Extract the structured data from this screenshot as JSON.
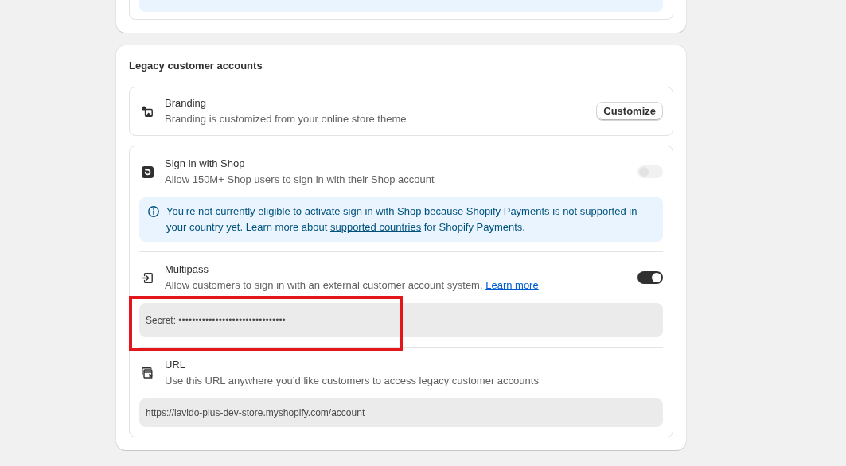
{
  "section": {
    "title": "Legacy customer accounts",
    "branding": {
      "title": "Branding",
      "description": "Branding is customized from your online store theme",
      "button": "Customize"
    },
    "settings": [
      {
        "title": "Sign in with Shop",
        "description": "Allow 150M+ Shop users to sign in with their Shop account",
        "toggle": {
          "on": false,
          "disabled": true
        },
        "notice": {
          "text": "You’re not currently eligible to activate sign in with Shop because Shopify Payments is not supported in your country yet. Learn more about",
          "link": "supported countries",
          "text_after": "for Shopify Payments."
        }
      },
      {
        "title": "Multipass",
        "description": "Allow customers to sign in with an external customer account system.",
        "link": "Learn more",
        "toggle": {
          "on": true,
          "disabled": false
        },
        "field": {
          "kind": "secret",
          "value": "Secret: ••••••••••••••••••••••••••••••••",
          "highlighted": true
        }
      },
      {
        "title": "URL",
        "description": "Use this URL anywhere you’d like customers to access legacy customer accounts",
        "field": {
          "kind": "text",
          "value": "https://lavido-plus-dev-store.myshopify.com/account"
        }
      }
    ]
  }
}
